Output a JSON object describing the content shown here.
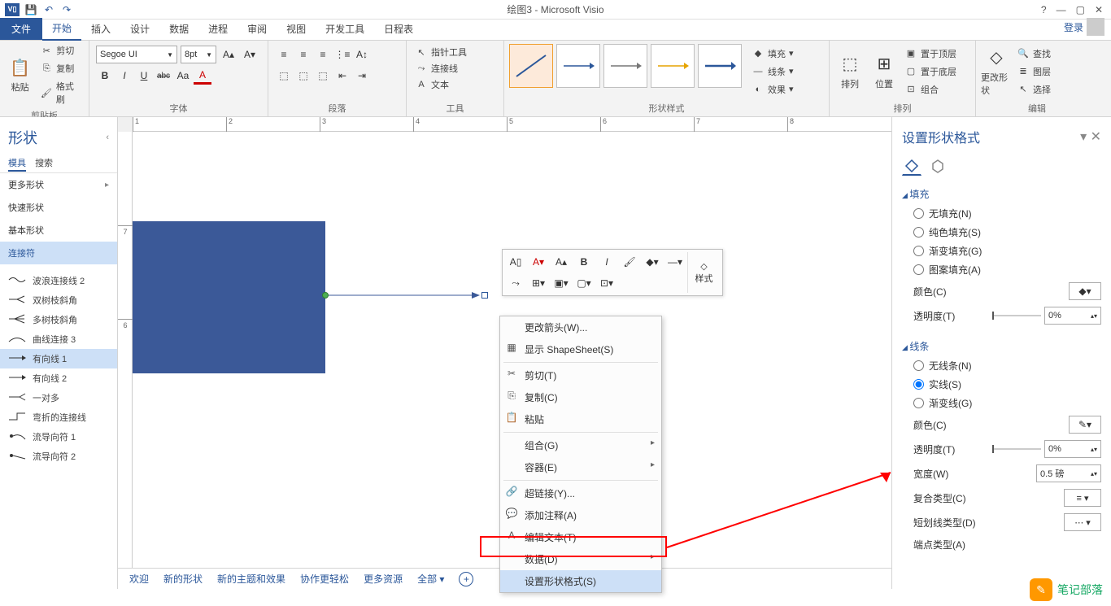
{
  "title": "绘图3 - Microsoft Visio",
  "qat": {
    "visio": "V▯",
    "save": "💾",
    "undo": "↶",
    "redo": "↷"
  },
  "wincontrols": {
    "help": "?",
    "min": "—",
    "max": "▢",
    "close": "✕"
  },
  "menutabs": [
    "文件",
    "开始",
    "插入",
    "设计",
    "数据",
    "进程",
    "审阅",
    "视图",
    "开发工具",
    "日程表"
  ],
  "login": "登录",
  "ribbon": {
    "clipboard": {
      "paste": "粘贴",
      "cut": "剪切",
      "copy": "复制",
      "format": "格式刷",
      "label": "剪贴板"
    },
    "font": {
      "name": "Segoe UI",
      "size": "8pt",
      "label": "字体",
      "bold": "B",
      "italic": "I",
      "underline": "U",
      "strike": "abc",
      "Aa": "Aa"
    },
    "para": {
      "label": "段落"
    },
    "tools": {
      "pointer": "指针工具",
      "connector": "连接线",
      "text": "文本",
      "label": "工具"
    },
    "styles": {
      "label": "形状样式"
    },
    "stylefx": {
      "fill": "填充",
      "line": "线条",
      "effect": "效果"
    },
    "arrange": {
      "arr": "排列",
      "pos": "位置",
      "top": "置于顶层",
      "bottom": "置于底层",
      "group": "组合",
      "label": "排列"
    },
    "edit": {
      "change": "更改形状",
      "find": "查找",
      "layer": "图层",
      "select": "选择",
      "label": "编辑"
    }
  },
  "shapepanel": {
    "title": "形状",
    "tabs": [
      "模具",
      "搜索"
    ],
    "cats": [
      "更多形状",
      "快速形状",
      "基本形状",
      "连接符"
    ],
    "items": [
      "波浪连接线 2",
      "双树枝斜角",
      "多树枝斜角",
      "曲线连接 3",
      "有向线 1",
      "有向线 2",
      "一对多",
      "弯折的连接线",
      "流导向符 1",
      "流导向符 2"
    ]
  },
  "ruler_h": [
    "1",
    "2",
    "3",
    "4",
    "5",
    "6",
    "7",
    "8"
  ],
  "ruler_v": [
    "6",
    "7"
  ],
  "minitb": {
    "style": "样式"
  },
  "ctx": {
    "changeArrow": "更改箭头(W)...",
    "showSheet": "显示 ShapeSheet(S)",
    "cut": "剪切(T)",
    "copy": "复制(C)",
    "paste": "粘贴",
    "group": "组合(G)",
    "container": "容器(E)",
    "hyperlink": "超链接(Y)...",
    "comment": "添加注释(A)",
    "editText": "编辑文本(T)",
    "data": "数据(D)",
    "format": "设置形状格式(S)"
  },
  "rightpane": {
    "title": "设置形状格式",
    "fill": {
      "hdr": "填充",
      "none": "无填充(N)",
      "solid": "纯色填充(S)",
      "gradient": "渐变填充(G)",
      "pattern": "图案填充(A)",
      "color": "颜色(C)",
      "trans": "透明度(T)",
      "transval": "0%"
    },
    "line": {
      "hdr": "线条",
      "none": "无线条(N)",
      "solid": "实线(S)",
      "gradient": "渐变线(G)",
      "color": "颜色(C)",
      "trans": "透明度(T)",
      "transval": "0%",
      "width": "宽度(W)",
      "widthval": "0.5 磅",
      "compound": "复合类型(C)",
      "dash": "短划线类型(D)",
      "cap": "端点类型(A)"
    }
  },
  "tabsbottom": [
    "欢迎",
    "新的形状",
    "新的主题和效果",
    "协作更轻松",
    "更多资源",
    "全部 ▾"
  ],
  "watermark": "笔记部落"
}
